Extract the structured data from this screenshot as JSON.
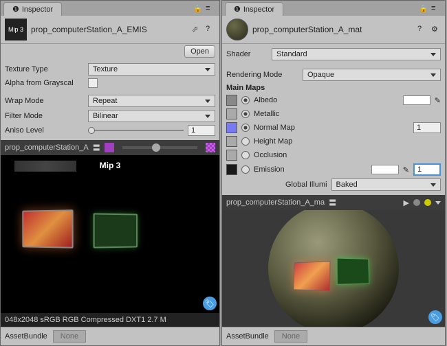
{
  "left": {
    "tab": "Inspector",
    "title": "prop_computerStation_A_EMIS",
    "open_btn": "Open",
    "textureType": {
      "label": "Texture Type",
      "value": "Texture"
    },
    "alphaGrayscale": {
      "label": "Alpha from Grayscal",
      "checked": false
    },
    "wrapMode": {
      "label": "Wrap Mode",
      "value": "Repeat"
    },
    "filterMode": {
      "label": "Filter Mode",
      "value": "Bilinear"
    },
    "anisoLevel": {
      "label": "Aniso Level",
      "value": "1"
    },
    "previewTitle": "prop_computerStation_A",
    "mipLabel": "Mip 3",
    "footerLine": "048x2048 sRGB  RGB Compressed DXT1   2.7 M",
    "assetBundle": {
      "label": "AssetBundle",
      "value": "None"
    }
  },
  "right": {
    "tab": "Inspector",
    "title": "prop_computerStation_A_mat",
    "shader": {
      "label": "Shader",
      "value": "Standard"
    },
    "renderMode": {
      "label": "Rendering Mode",
      "value": "Opaque"
    },
    "mainMaps": "Main Maps",
    "albedo": "Albedo",
    "metallic": "Metallic",
    "normal": {
      "label": "Normal Map",
      "value": "1"
    },
    "height": "Height Map",
    "occlusion": "Occlusion",
    "emission": {
      "label": "Emission",
      "value": "1"
    },
    "globalIllum": {
      "label": "Global Illumi",
      "value": "Baked"
    },
    "previewTitle": "prop_computerStation_A_ma",
    "assetBundle": {
      "label": "AssetBundle",
      "value": "None"
    }
  }
}
